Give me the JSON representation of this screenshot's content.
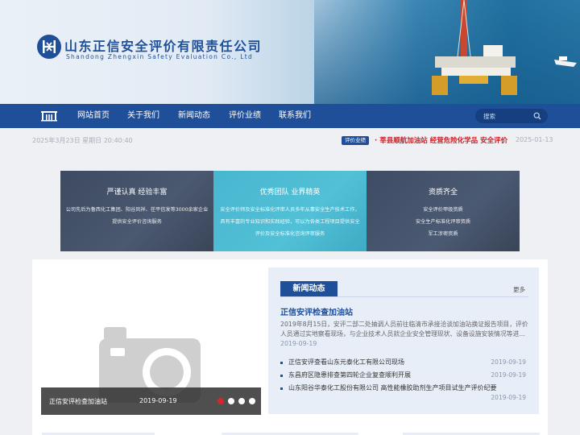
{
  "header": {
    "company_cn": "山东正信安全评价有限责任公司",
    "company_en": "Shandong Zhengxin Safety Evaluation Co., Ltd",
    "logo_icon": "hx-logo-icon",
    "brand_color": "#1f4f99"
  },
  "nav": {
    "home_icon": "home-gate-icon",
    "items": [
      "网站首页",
      "关于我们",
      "新闻动态",
      "评价业绩",
      "联系我们"
    ],
    "search_placeholder": "搜索"
  },
  "infobar": {
    "datetime": "2025年3月23日 星期日 20:40:40",
    "ticker_tag": "评价业绩",
    "ticker_text": "· 莘县顺航加油站 经营危险化学品 安全评价",
    "ticker_date": "2025-01-13",
    "ticker_color": "#c81f25"
  },
  "panels": [
    {
      "title": "严谨认真 经验丰富",
      "lines": [
        "公司先后为鲁西化工集团、阳谷凤祥、茌平信发等3000余家企业",
        "提供安全评价咨询服务"
      ]
    },
    {
      "title": "优秀团队 业界精英",
      "lines": [
        "安全评价师及安全标准化评审人员多年从事安全生产技术工作，",
        "具有丰富的专业知识和实践经验，可以为各类工程项目提供安全",
        "评价及安全标准化咨询评审服务"
      ]
    },
    {
      "title": "资质齐全",
      "lines": [
        "安全评价甲级资质",
        "安全生产标准化评审资质",
        "军工涉密资质"
      ]
    }
  ],
  "slider": {
    "caption_title": "正信安评检查加油站",
    "caption_date": "2019-09-19",
    "dots_total": 4,
    "active_dot": 1,
    "placeholder_icon": "camera-placeholder-icon"
  },
  "news": {
    "tab_label": "新闻动态",
    "more_label": "更多",
    "headline": "正信安评检查加油站",
    "summary": "2019年8月15日，安评二部二处抽调人员前往临清市承接洽谈加油站换证报告项目，评价人员通过实地察看现场，与企业技术人员就企业安全管理现状、设备设施安装情况等进...",
    "summary_date": "2019-09-19",
    "items": [
      {
        "title": "正信安评查看山东元泰化工有限公司现场",
        "date": "2019-09-19"
      },
      {
        "title": "东昌府区隐患排查第四轮企业复查顺利开展",
        "date": "2019-09-19"
      },
      {
        "title": "山东阳谷华泰化工股份有限公司 高性能橡胶助剂生产项目试生产评价纪要",
        "date": "2019-09-19"
      }
    ]
  }
}
